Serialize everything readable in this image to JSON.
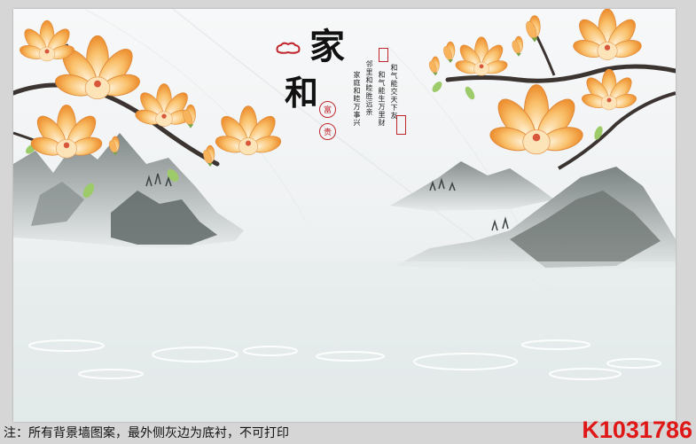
{
  "artwork": {
    "title_chars": [
      "家",
      "和"
    ],
    "round_seals": [
      "富",
      "贵"
    ],
    "poem_columns": [
      "和气能交天下友",
      "和气能生万里财",
      "邻里和睦胜远亲",
      "家庭和睦万事兴"
    ],
    "colors": {
      "sky": "#f2f4f5",
      "water": "#dfe6e6",
      "mountain": "#7d8585",
      "blossom_outer": "#f6b24a",
      "blossom_inner": "#fde7c2",
      "branch": "#3b3431",
      "seal_red": "#c0272d"
    }
  },
  "footer": {
    "notice": "注：所有背景墙图案，最外侧灰边为底衬，不可打印",
    "product_code": "K1031786"
  }
}
